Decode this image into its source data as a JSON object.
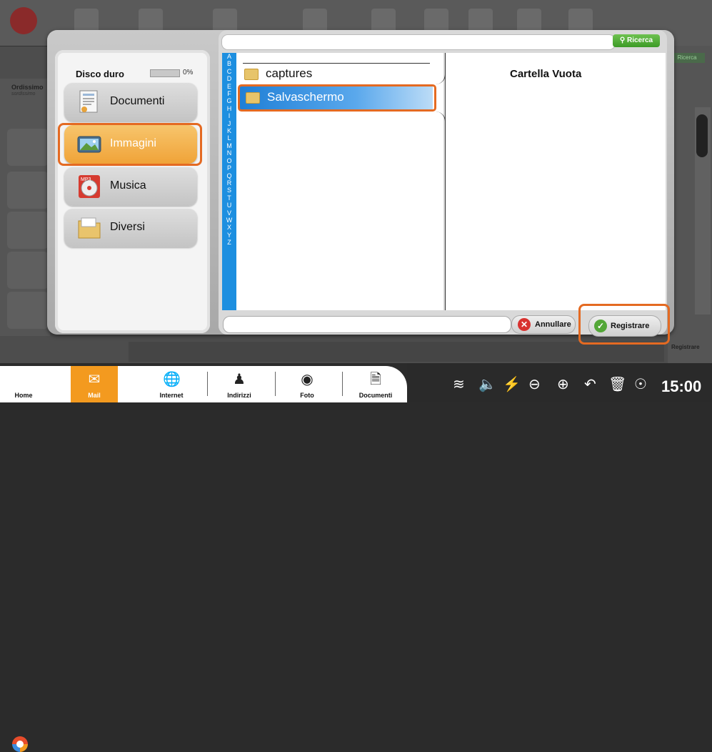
{
  "background": {
    "left_title": "Ordissimo",
    "left_subtitle": "sordissimo",
    "right_search": "Ricerca",
    "right_save": "Registrare"
  },
  "dialog": {
    "disk": {
      "title": "Disco duro",
      "usage": "0%"
    },
    "categories": [
      {
        "label": "Documenti",
        "icon": "documents-icon"
      },
      {
        "label": "Immagini",
        "icon": "image-icon"
      },
      {
        "label": "Musica",
        "icon": "music-cd-icon"
      },
      {
        "label": "Diversi",
        "icon": "folder-icon"
      }
    ],
    "search": {
      "placeholder": "",
      "button_label": "Ricerca"
    },
    "alphabet": [
      "A",
      "B",
      "C",
      "D",
      "E",
      "F",
      "G",
      "H",
      "I",
      "J",
      "K",
      "L",
      "M",
      "N",
      "O",
      "P",
      "Q",
      "R",
      "S",
      "T",
      "U",
      "V",
      "W",
      "X",
      "Y",
      "Z"
    ],
    "folders": [
      "captures",
      "Salvaschermo"
    ],
    "preview_label": "Cartella Vuota",
    "filename_value": "",
    "cancel_label": "Annullare",
    "save_label": "Registrare"
  },
  "taskbar": {
    "items": [
      {
        "label": "Home"
      },
      {
        "label": "Mail"
      },
      {
        "label": "Internet"
      },
      {
        "label": "Indirizzi"
      },
      {
        "label": "Foto"
      },
      {
        "label": "Documenti"
      }
    ],
    "clock": "15:00"
  },
  "colors": {
    "accent_orange": "#f39a1f",
    "highlight": "#e46a22",
    "alphabet_blue": "#1d8fe0",
    "selection_blue": "#1f7fd6"
  }
}
